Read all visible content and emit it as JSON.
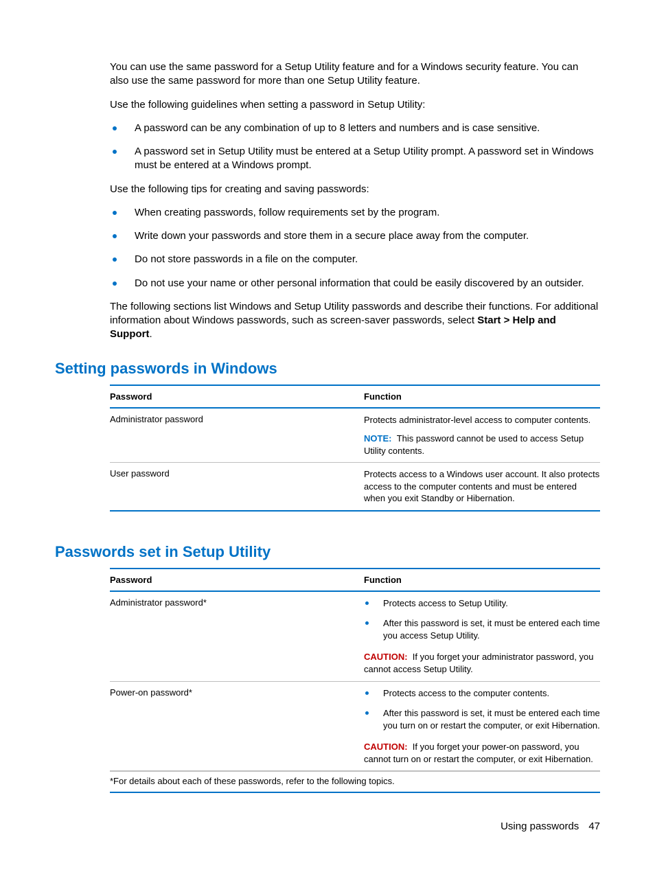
{
  "intro": {
    "p1": "You can use the same password for a Setup Utility feature and for a Windows security feature. You can also use the same password for more than one Setup Utility feature.",
    "p2": "Use the following guidelines when setting a password in Setup Utility:",
    "guidelines": [
      "A password can be any combination of up to 8 letters and numbers and is case sensitive.",
      "A password set in Setup Utility must be entered at a Setup Utility prompt. A password set in Windows must be entered at a Windows prompt."
    ],
    "p3": "Use the following tips for creating and saving passwords:",
    "tips": [
      "When creating passwords, follow requirements set by the program.",
      "Write down your passwords and store them in a secure place away from the computer.",
      "Do not store passwords in a file on the computer.",
      "Do not use your name or other personal information that could be easily discovered by an outsider."
    ],
    "p4a": "The following sections list Windows and Setup Utility passwords and describe their functions. For additional information about Windows passwords, such as screen-saver passwords, select ",
    "p4b": "Start > Help and Support",
    "p4c": "."
  },
  "section1": {
    "heading": "Setting passwords in Windows",
    "th1": "Password",
    "th2": "Function",
    "rows": [
      {
        "name": "Administrator password",
        "desc": "Protects administrator-level access to computer contents.",
        "noteLabel": "NOTE:",
        "note": "This password cannot be used to access Setup Utility contents."
      },
      {
        "name": "User password",
        "desc": "Protects access to a Windows user account. It also protects access to the computer contents and must be entered when you exit Standby or Hibernation."
      }
    ]
  },
  "section2": {
    "heading": "Passwords set in Setup Utility",
    "th1": "Password",
    "th2": "Function",
    "rows": [
      {
        "name": "Administrator password*",
        "bullets": [
          "Protects access to Setup Utility.",
          "After this password is set, it must be entered each time you access Setup Utility."
        ],
        "cautionLabel": "CAUTION:",
        "caution": "If you forget your administrator password, you cannot access Setup Utility."
      },
      {
        "name": "Power-on password*",
        "bullets": [
          "Protects access to the computer contents.",
          "After this password is set, it must be entered each time you turn on or restart the computer, or exit Hibernation."
        ],
        "cautionLabel": "CAUTION:",
        "caution": "If you forget your power-on password, you cannot turn on or restart the computer, or exit Hibernation."
      }
    ],
    "footnote": "*For details about each of these passwords, refer to the following topics."
  },
  "footer": {
    "label": "Using passwords",
    "page": "47"
  }
}
